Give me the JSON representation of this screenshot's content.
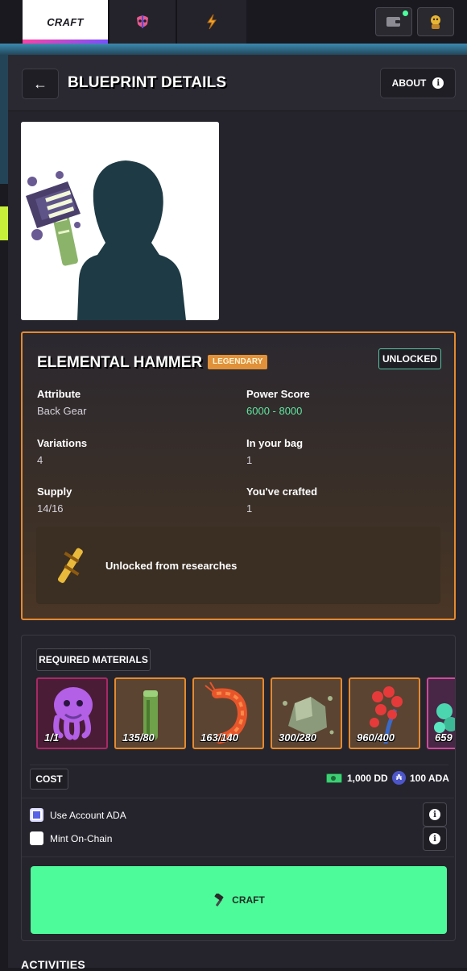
{
  "nav": {
    "tabs": [
      {
        "label": "CRAFT",
        "icon": "hammer-icon",
        "active": true
      },
      {
        "label": "",
        "icon": "mask-icon"
      },
      {
        "label": "",
        "icon": "lightning-icon"
      }
    ],
    "accent_gradient": [
      "#ff3fa4",
      "#7b4dff"
    ]
  },
  "header": {
    "title": "BLUEPRINT DETAILS",
    "about_label": "ABOUT"
  },
  "item": {
    "name": "ELEMENTAL HAMMER",
    "rarity": "LEGENDARY",
    "status": "UNLOCKED",
    "attributes": [
      {
        "label": "Attribute",
        "value": "Back Gear"
      },
      {
        "label": "Power Score",
        "value": "6000 - 8000"
      },
      {
        "label": "Variations",
        "value": "4"
      },
      {
        "label": "In your bag",
        "value": "1"
      },
      {
        "label": "Supply",
        "value": "14/16"
      },
      {
        "label": "You've crafted",
        "value": "1"
      }
    ],
    "unlock_text": "Unlocked from researches",
    "colors": {
      "legendary": "#e58a2f",
      "power_score": "#5ee8a0"
    }
  },
  "materials": {
    "title": "REQUIRED MATERIALS",
    "items": [
      {
        "count": "1/1",
        "icon": "octopus-icon"
      },
      {
        "count": "135/80",
        "icon": "bamboo-icon"
      },
      {
        "count": "163/140",
        "icon": "shrimp-icon"
      },
      {
        "count": "300/280",
        "icon": "rock-icon"
      },
      {
        "count": "960/400",
        "icon": "berries-icon"
      },
      {
        "count": "659",
        "icon": "crystal-icon"
      }
    ]
  },
  "cost": {
    "label": "COST",
    "dd": "1,000 DD",
    "ada": "100 ADA"
  },
  "options": [
    {
      "label": "Use Account ADA",
      "checked": true
    },
    {
      "label": "Mint On-Chain",
      "checked": false
    }
  ],
  "craft_button": "CRAFT",
  "activities_title": "ACTIVITIES"
}
